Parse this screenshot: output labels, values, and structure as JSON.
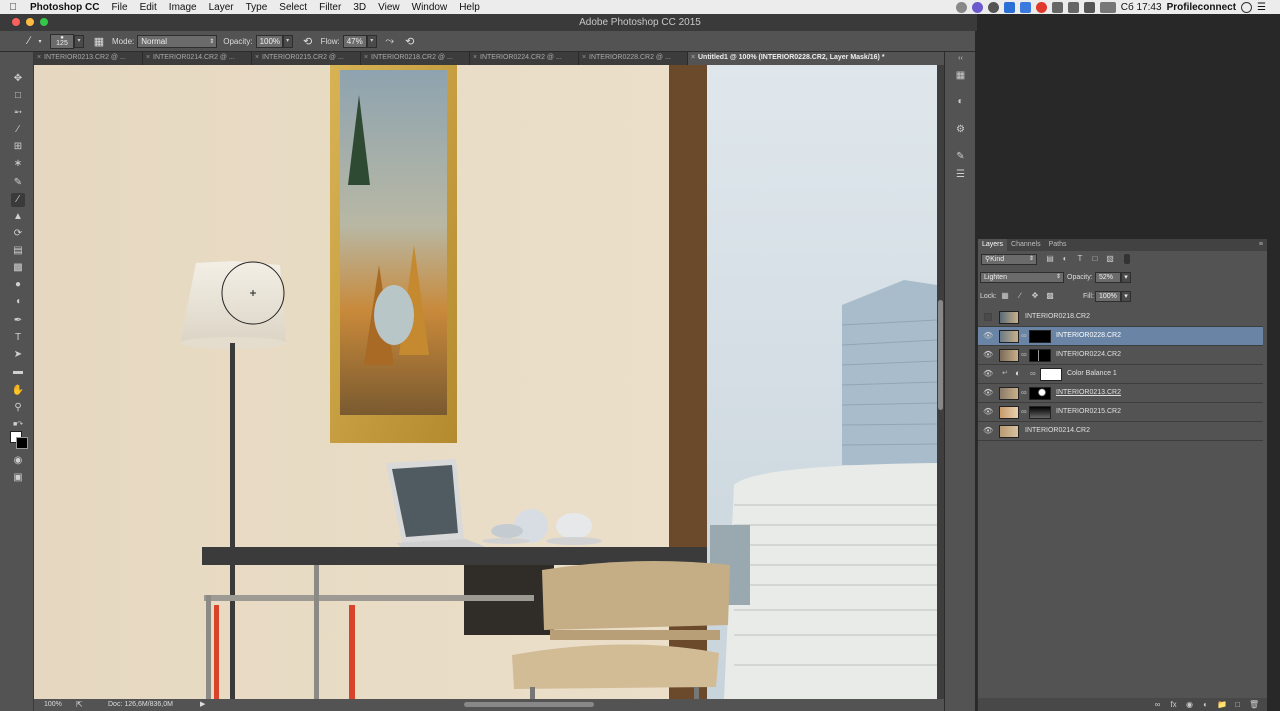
{
  "menubar": {
    "app_name": "Photoshop CC",
    "items": [
      "File",
      "Edit",
      "Image",
      "Layer",
      "Type",
      "Select",
      "Filter",
      "3D",
      "View",
      "Window",
      "Help"
    ],
    "clock": "Сб 17:43",
    "user": "Profileconnect"
  },
  "titlebar": {
    "title": "Adobe Photoshop CC 2015"
  },
  "options": {
    "brush_size": "125",
    "mode_label": "Mode:",
    "mode_value": "Normal",
    "opacity_label": "Opacity:",
    "opacity_value": "100%",
    "flow_label": "Flow:",
    "flow_value": "47%"
  },
  "tabs": [
    "INTERIOR0213.CR2 @ ...",
    "INTERIOR0214.CR2 @ ...",
    "INTERIOR0215.CR2 @ ...",
    "INTERIOR0218.CR2 @ ...",
    "INTERIOR0224.CR2 @ ...",
    "INTERIOR0228.CR2 @ ...",
    "Untitled1 @ 100% (INTERIOR0228.CR2, Layer Mask/16) *"
  ],
  "statusbar": {
    "zoom": "100%",
    "doc": "Doc: 126,6M/836,0M"
  },
  "layers_panel": {
    "tabs": [
      "Layers",
      "Channels",
      "Paths"
    ],
    "filter_kind": "Kind",
    "blend_mode": "Lighten",
    "opacity_label": "Opacity:",
    "opacity_value": "52%",
    "lock_label": "Lock:",
    "fill_label": "Fill:",
    "fill_value": "100%",
    "layers": [
      {
        "name": "INTERIOR0218.CR2",
        "visible": false,
        "selected": false
      },
      {
        "name": "INTERIOR0228.CR2",
        "visible": true,
        "selected": true
      },
      {
        "name": "INTERIOR0224.CR2",
        "visible": true,
        "selected": false
      },
      {
        "name": "Color Balance 1",
        "visible": true,
        "selected": false
      },
      {
        "name": "INTERIOR0213.CR2",
        "visible": true,
        "selected": false
      },
      {
        "name": "INTERIOR0215.CR2",
        "visible": true,
        "selected": false
      },
      {
        "name": "INTERIOR0214.CR2",
        "visible": true,
        "selected": false
      }
    ]
  }
}
